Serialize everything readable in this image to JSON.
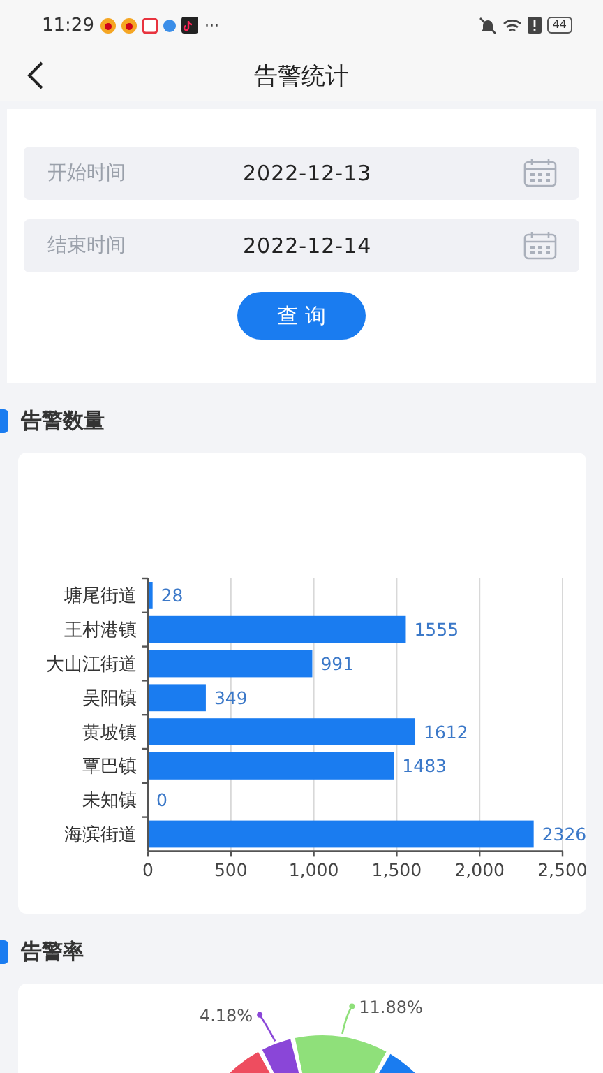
{
  "status_bar": {
    "time": "11:29",
    "more": "···",
    "battery": "44"
  },
  "header": {
    "title": "告警统计"
  },
  "filter": {
    "fields": [
      {
        "label": "开始时间",
        "value": "2022-12-13"
      },
      {
        "label": "结束时间",
        "value": "2022-12-14"
      }
    ],
    "button": "查 询"
  },
  "count_section": {
    "title": "告警数量",
    "chart_data": {
      "type": "bar",
      "orientation": "horizontal",
      "categories": [
        "塘尾街道",
        "王村港镇",
        "大山江街道",
        "吴阳镇",
        "黄坡镇",
        "覃巴镇",
        "未知镇",
        "海滨街道"
      ],
      "series": [
        {
          "color": "#1a7cf0",
          "values": [
            28,
            1555,
            991,
            349,
            1612,
            1483,
            0,
            2326
          ]
        }
      ],
      "xlim": [
        0,
        2500
      ],
      "xticks": [
        {
          "value": 0,
          "label": "0"
        },
        {
          "value": 500,
          "label": "500"
        },
        {
          "value": 1000,
          "label": "1,000"
        },
        {
          "value": 1500,
          "label": "1,500"
        },
        {
          "value": 2000,
          "label": "2,000"
        },
        {
          "value": 2500,
          "label": "2,500"
        }
      ],
      "data_labels": true,
      "grid": true
    }
  },
  "rate_section": {
    "title": "告警率",
    "slices": [
      {
        "color": "#ee4d5f"
      },
      {
        "color": "#8a46d8",
        "label": "4.18%"
      },
      {
        "color": "#8fe07a",
        "label": "11.88%"
      },
      {
        "color": "#1a7cf0"
      }
    ]
  }
}
